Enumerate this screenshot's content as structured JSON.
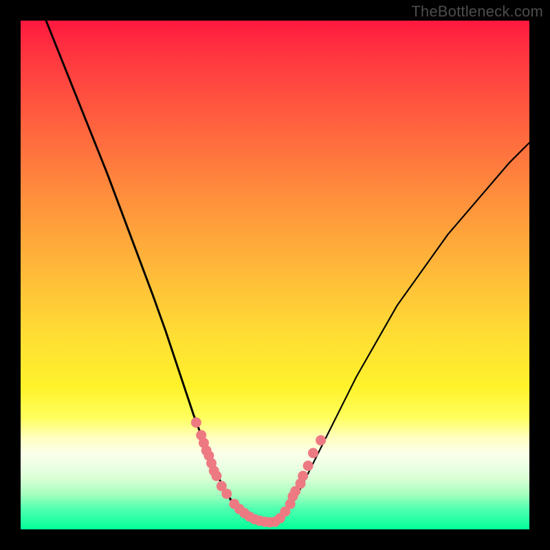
{
  "watermark": "TheBottleneck.com",
  "chart_data": {
    "type": "line",
    "title": "",
    "xlabel": "",
    "ylabel": "",
    "xlim": [
      0,
      100
    ],
    "ylim": [
      0,
      100
    ],
    "curve_left": {
      "x": [
        5,
        9,
        13,
        17,
        20,
        23,
        26,
        28.5,
        30.5,
        32.5,
        34,
        35.5,
        37,
        38.5,
        40,
        41.5,
        43,
        44.5
      ],
      "y": [
        100,
        90,
        80,
        70,
        62,
        54,
        46,
        39,
        33,
        27,
        22.5,
        18.5,
        14.5,
        11,
        8,
        5.5,
        3.5,
        2
      ]
    },
    "curve_floor": {
      "x": [
        44.5,
        46,
        48,
        50
      ],
      "y": [
        2,
        1.5,
        1.3,
        1.5
      ]
    },
    "curve_right": {
      "x": [
        50,
        52,
        54,
        56,
        60,
        66,
        74,
        84,
        96,
        100
      ],
      "y": [
        1.5,
        3,
        6,
        10,
        18,
        30,
        44,
        58,
        72,
        76
      ]
    },
    "markers_left": {
      "x": [
        34.5,
        35.5,
        36,
        36.5,
        37,
        37.5,
        38,
        38.5,
        39.5,
        40.5,
        42,
        43,
        44,
        45,
        46,
        47,
        48,
        49
      ],
      "y": [
        21,
        18.5,
        17,
        15.5,
        14.5,
        13,
        11.5,
        10.5,
        8.5,
        7,
        5,
        4,
        3.2,
        2.5,
        2,
        1.7,
        1.5,
        1.4
      ]
    },
    "markers_right": {
      "x": [
        50,
        51,
        52,
        53,
        53.5,
        54,
        55,
        55.5,
        56.5,
        57.5,
        59
      ],
      "y": [
        1.5,
        2.2,
        3.5,
        5,
        6.5,
        7.5,
        9,
        10.5,
        12.5,
        15,
        17.5
      ]
    },
    "marker_color": "#ed7a82",
    "curve_color": "#000000"
  }
}
